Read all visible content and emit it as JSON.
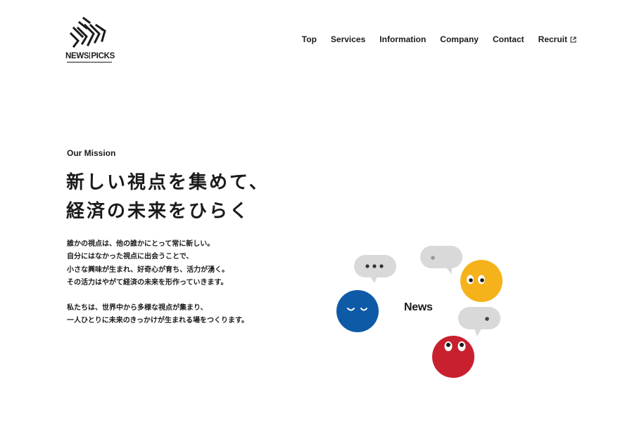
{
  "brand": {
    "logo_text_left": "NEWS",
    "logo_text_right": "PICKS"
  },
  "nav": {
    "items": [
      {
        "label": "Top"
      },
      {
        "label": "Services"
      },
      {
        "label": "Information"
      },
      {
        "label": "Company"
      },
      {
        "label": "Contact"
      },
      {
        "label": "Recruit",
        "icon": "external-link-icon"
      }
    ]
  },
  "hero": {
    "eyebrow": "Our Mission",
    "headline_line1": "新しい視点を集めて、",
    "headline_line2": "経済の未来をひらく",
    "body_lines": [
      "誰かの視点は、他の誰かにとって常に新しい。",
      "自分にはなかった視点に出会うことで、",
      "小さな興味が生まれ、好奇心が育ち、活力が湧く。",
      "その活力はやがて経済の未来を形作っていきます。",
      "私たちは、世界中から多様な視点が集まり、",
      "一人ひとりに未来のきっかけが生まれる場をつくります。"
    ]
  },
  "illustration": {
    "center_label": "News",
    "colors": {
      "blue": "#0e5aa7",
      "yellow": "#f5b21a",
      "red": "#c8202e",
      "bubble": "#d9d9d9"
    }
  }
}
